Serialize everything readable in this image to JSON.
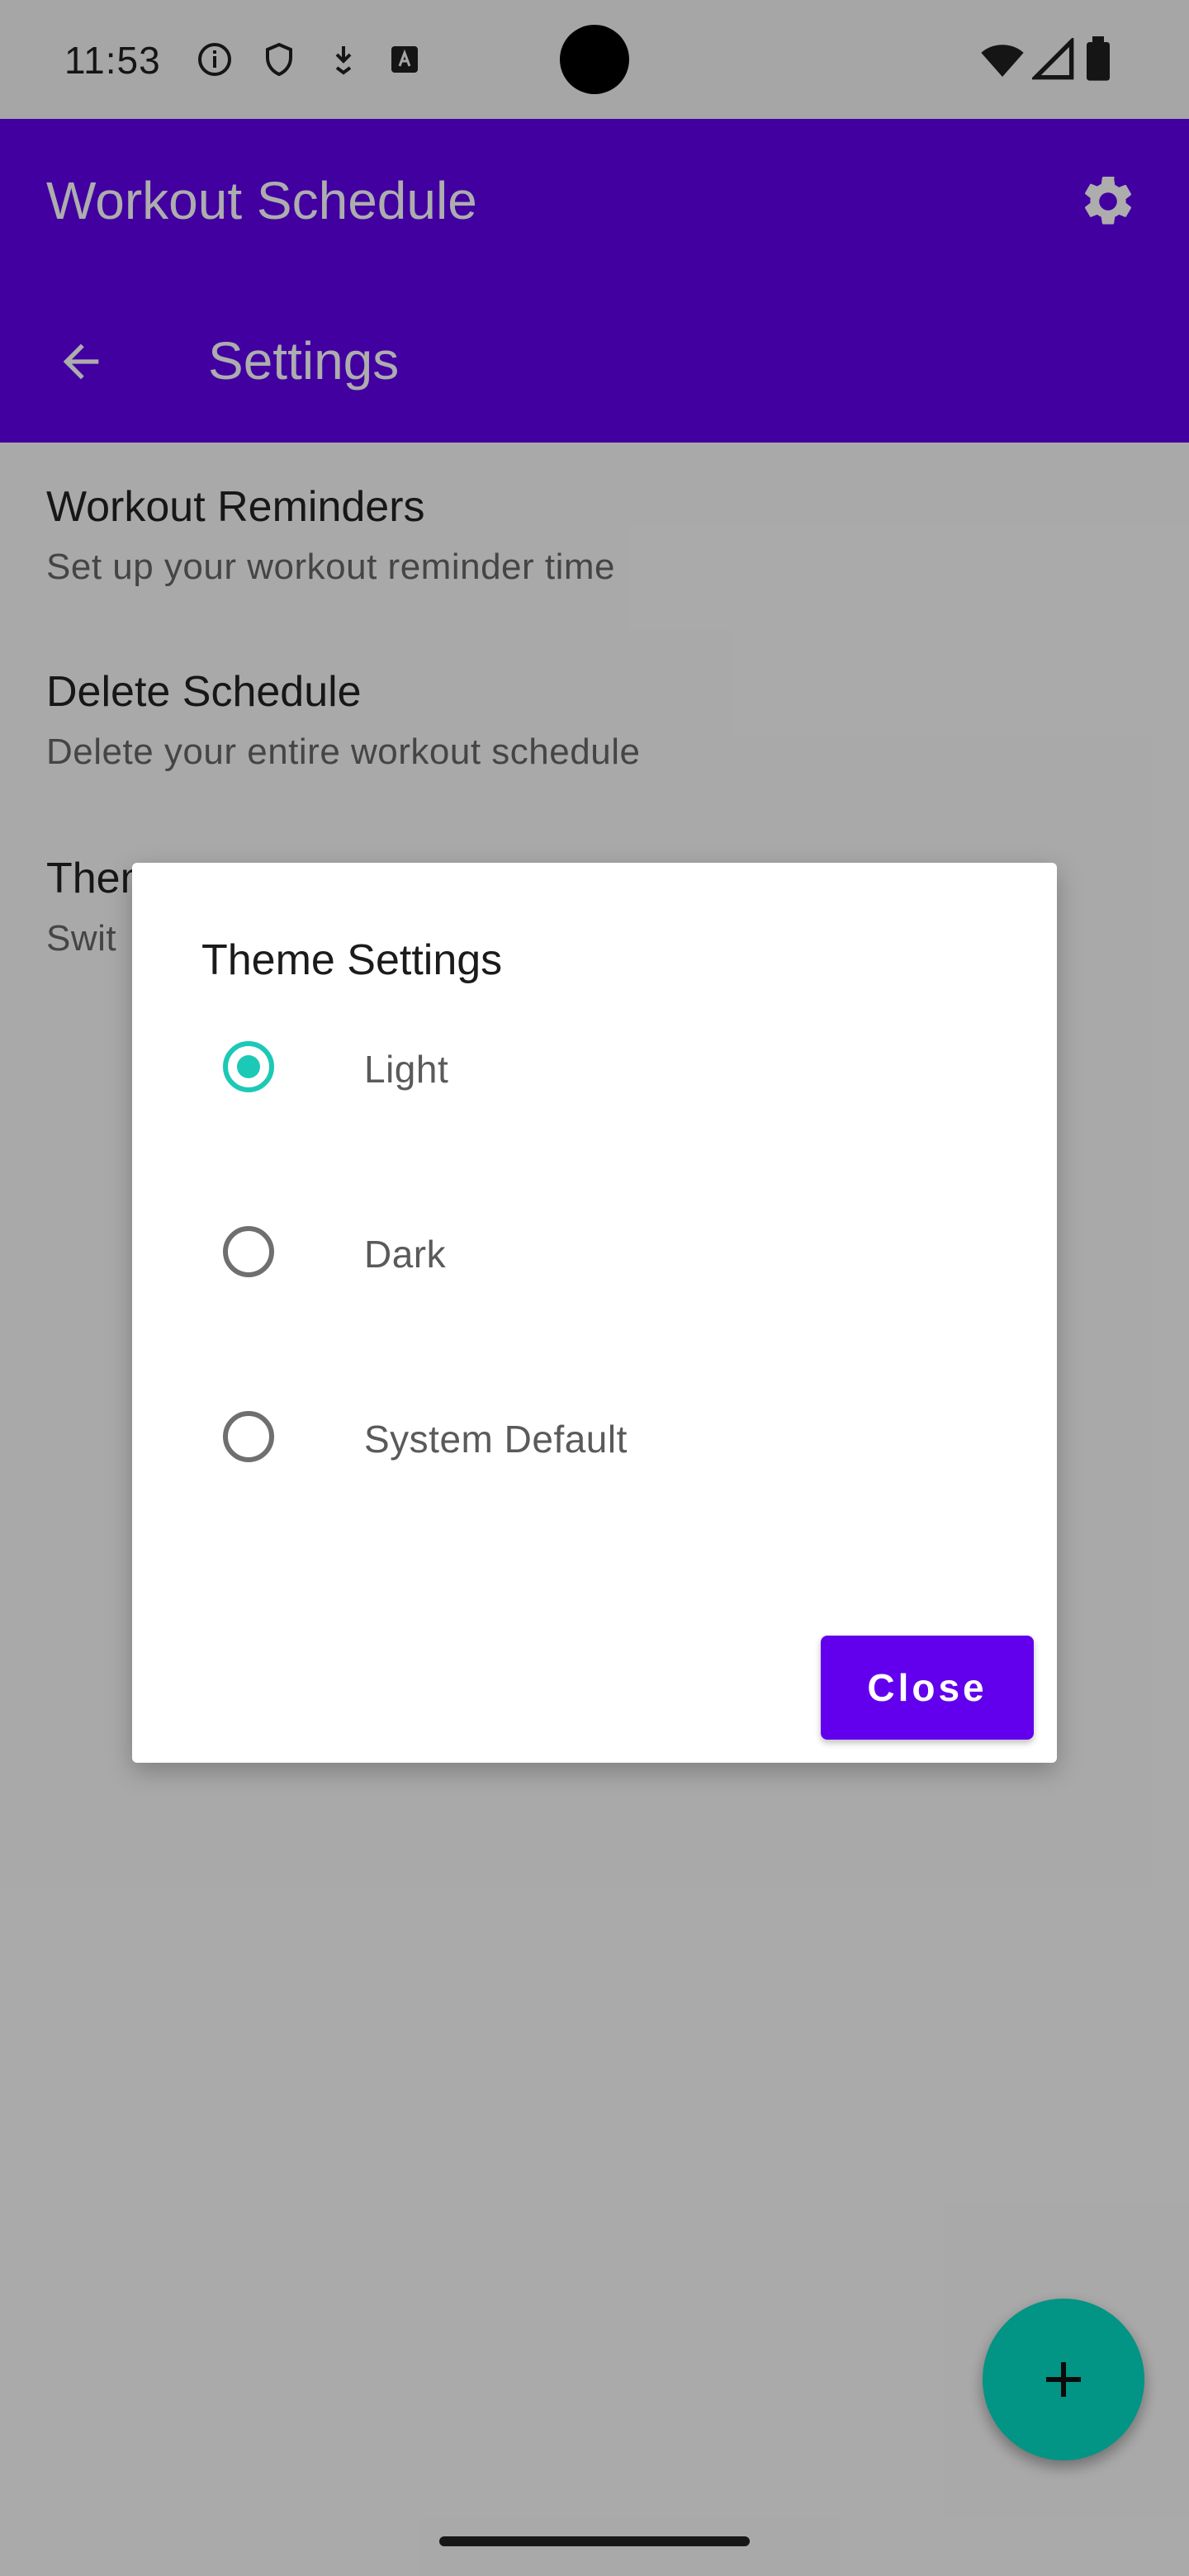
{
  "status_bar": {
    "time": "11:53",
    "left_icons": [
      "info-icon",
      "shield-icon",
      "download-icon",
      "text-box-icon"
    ],
    "right_icons": [
      "wifi-icon",
      "signal-icon",
      "battery-icon"
    ]
  },
  "app_bar": {
    "title": "Workout Schedule",
    "settings_icon": "gear-icon",
    "back_icon": "arrow-left-icon",
    "page_title": "Settings",
    "color": "#6200ee"
  },
  "settings": [
    {
      "title": "Workout Reminders",
      "subtitle": "Set up your workout reminder time"
    },
    {
      "title": "Delete Schedule",
      "subtitle": "Delete your entire workout schedule"
    },
    {
      "title": "Them",
      "subtitle": "Swit"
    }
  ],
  "dialog": {
    "title": "Theme Settings",
    "options": [
      {
        "label": "Light",
        "selected": true
      },
      {
        "label": "Dark",
        "selected": false
      },
      {
        "label": "System Default",
        "selected": false
      }
    ],
    "close_label": "Close",
    "accent_color": "#1bc9b6"
  },
  "fab": {
    "icon": "plus-icon",
    "color": "#03dac5"
  }
}
